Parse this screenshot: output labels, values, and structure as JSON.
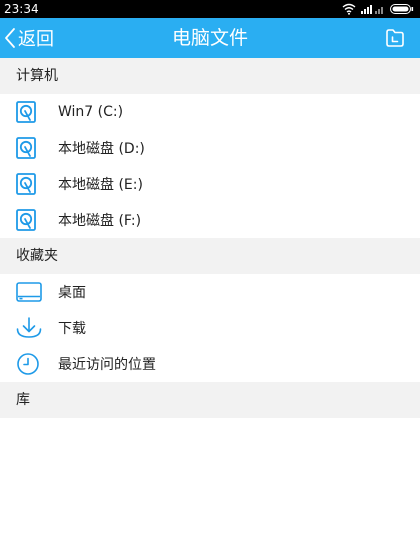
{
  "status": {
    "time": "23:34"
  },
  "header": {
    "back_label": "返回",
    "title": "电脑文件"
  },
  "colors": {
    "accent": "#2aaef2",
    "section_bg": "#f2f2f2",
    "icon_blue": "#1e9ae8"
  },
  "sections": [
    {
      "title": "计算机",
      "items": [
        {
          "label": "Win7 (C:)",
          "icon": "hard-drive-icon"
        },
        {
          "label": "本地磁盘 (D:)",
          "icon": "hard-drive-icon"
        },
        {
          "label": "本地磁盘 (E:)",
          "icon": "hard-drive-icon"
        },
        {
          "label": "本地磁盘 (F:)",
          "icon": "hard-drive-icon"
        }
      ]
    },
    {
      "title": "收藏夹",
      "items": [
        {
          "label": "桌面",
          "icon": "desktop-icon"
        },
        {
          "label": "下载",
          "icon": "download-icon"
        },
        {
          "label": "最近访问的位置",
          "icon": "clock-icon"
        }
      ]
    },
    {
      "title": "库",
      "items": []
    }
  ]
}
